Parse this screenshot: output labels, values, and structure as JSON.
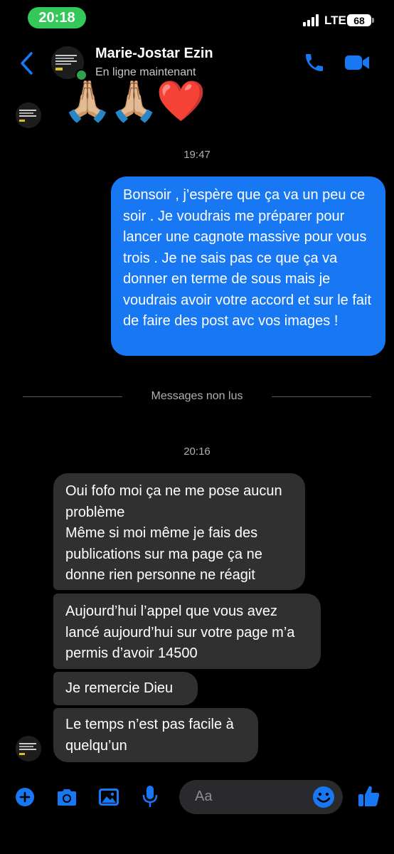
{
  "status_bar": {
    "time": "20:18",
    "network": "LTE",
    "battery": "68"
  },
  "header": {
    "contact_name": "Marie-Jostar Ezin",
    "contact_status": "En ligne maintenant",
    "icons": [
      "back-icon",
      "call-icon",
      "video-call-icon"
    ]
  },
  "reaction_emojis": "🙏🏼🙏🏼❤️",
  "messages": {
    "time_1": "19:47",
    "outgoing_1": "Bonsoir , j’espère que ça va un peu ce soir . Je voudrais me préparer pour lancer une cagnote massive pour vous trois . Je ne sais pas ce que ça va donner en terme de sous mais je voudrais avoir votre accord  et sur le fait de faire des post avc vos images !",
    "divider": "Messages non lus",
    "time_2": "20:16",
    "incoming_1": "Oui fofo moi ça ne me pose aucun problème\nMême si moi même je fais des publications sur ma page ça ne donne rien personne ne réagit",
    "incoming_2": "Aujourd’hui l’appel que vous avez lancé aujourd’hui sur votre page m’a permis d’avoir 14500",
    "incoming_3": "Je remercie Dieu",
    "incoming_4": "Le temps n’est pas facile à quelqu’un"
  },
  "composer": {
    "placeholder": "Aa"
  },
  "colors": {
    "accent": "#1877f2",
    "incoming_bubble": "#303030",
    "online": "#31a24c",
    "status_pill": "#34c759"
  }
}
